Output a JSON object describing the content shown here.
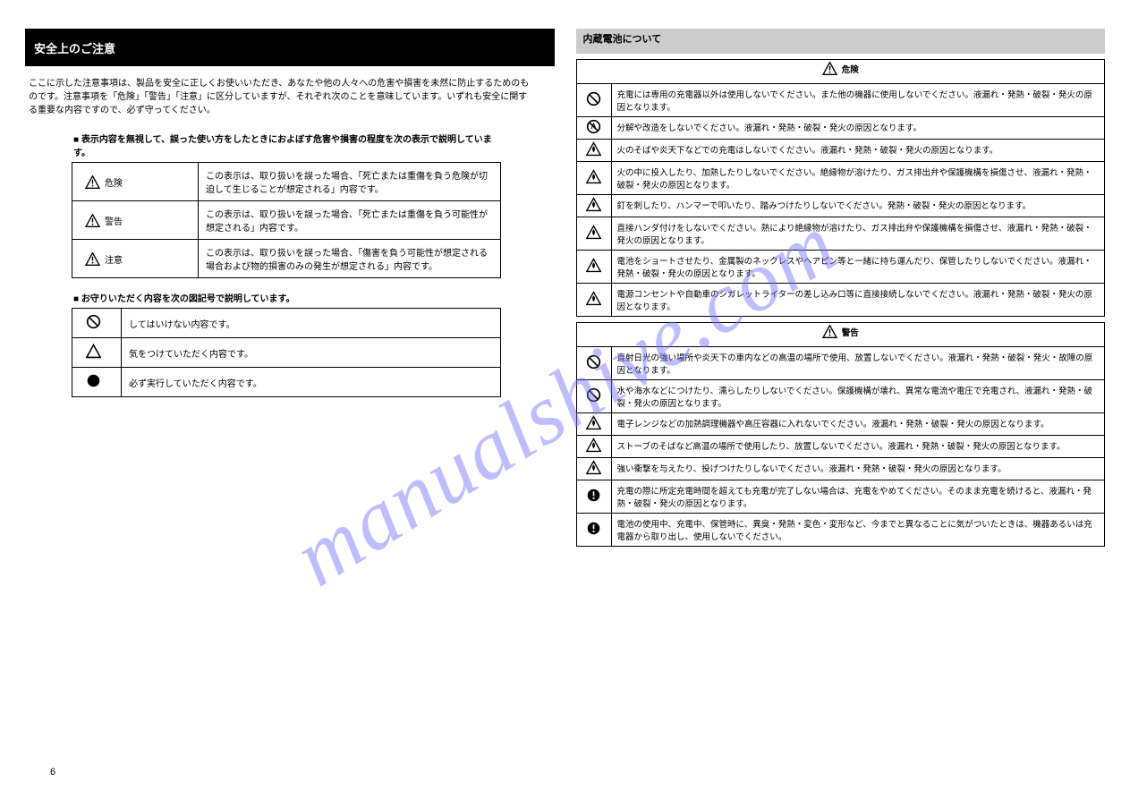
{
  "watermark": "manualshive.com",
  "left": {
    "header": "安全上のご注意",
    "intro": "ここに示した注意事項は、製品を安全に正しくお使いいただき、あなたや他の人々への危害や損害を未然に防止するためのものです。注意事項を「危険」「警告」「注意」に区分していますが、それぞれ次のことを意味しています。いずれも安全に関する重要な内容ですので、必ず守ってください。",
    "symExplain1": "■ 表示内容を無視して、誤った使い方をしたときにおよぼす危害や損害の程度を次の表示で説明しています。",
    "danger": {
      "label": "危険",
      "desc": "この表示は、取り扱いを誤った場合、「死亡または重傷を負う危険が切迫して生じることが想定される」内容です。"
    },
    "warning": {
      "label": "警告",
      "desc": "この表示は、取り扱いを誤った場合、「死亡または重傷を負う可能性が想定される」内容です。"
    },
    "caution": {
      "label": "注意",
      "desc": "この表示は、取り扱いを誤った場合、「傷害を負う可能性が想定される場合および物的損害のみの発生が想定される」内容です。"
    },
    "symExplain2": "■ お守りいただく内容を次の図記号で説明しています。",
    "prohibit": "してはいけない内容です。",
    "attention": "気をつけていただく内容です。",
    "mandatory": "必ず実行していただく内容です。"
  },
  "right": {
    "sectionTitle": "内蔵電池について",
    "dangerHeader": "危険",
    "dangerItems": [
      "充電には専用の充電器以外は使用しないでください。また他の機器に使用しないでください。液漏れ・発熱・破裂・発火の原因となります。",
      "分解や改造をしないでください。液漏れ・発熱・破裂・発火の原因となります。",
      "火のそばや炎天下などでの充電はしないでください。液漏れ・発熱・破裂・発火の原因となります。",
      "火の中に投入したり、加熱したりしないでください。絶縁物が溶けたり、ガス排出弁や保護機構を損傷させ、液漏れ・発熱・破裂・発火の原因となります。",
      "釘を刺したり、ハンマーで叩いたり、踏みつけたりしないでください。発熱・破裂・発火の原因となります。",
      "直接ハンダ付けをしないでください。熱により絶縁物が溶けたり、ガス排出弁や保護機構を損傷させ、液漏れ・発熱・破裂・発火の原因となります。",
      "電池をショートさせたり、金属製のネックレスやヘアピン等と一緒に持ち運んだり、保管したりしないでください。液漏れ・発熱・破裂・発火の原因となります。",
      "電源コンセントや自動車のシガレットライターの差し込み口等に直接接続しないでください。液漏れ・発熱・破裂・発火の原因となります。"
    ],
    "warningHeader": "警告",
    "warningItems": [
      "直射日光の強い場所や炎天下の車内などの高温の場所で使用、放置しないでください。液漏れ・発熱・破裂・発火・故障の原因となります。",
      "水や海水などにつけたり、濡らしたりしないでください。保護機構が壊れ、異常な電流や電圧で充電され、液漏れ・発熱・破裂・発火の原因となります。",
      "電子レンジなどの加熱調理機器や高圧容器に入れないでください。液漏れ・発熱・破裂・発火の原因となります。",
      "ストーブのそばなど高温の場所で使用したり、放置しないでください。液漏れ・発熱・破裂・発火の原因となります。",
      "強い衝撃を与えたり、投げつけたりしないでください。液漏れ・発熱・破裂・発火の原因となります。",
      "充電の際に所定充電時間を超えても充電が完了しない場合は、充電をやめてください。そのまま充電を続けると、液漏れ・発熱・破裂・発火の原因となります。",
      "電池の使用中、充電中、保管時に、異臭・発熱・変色・変形など、今までと異なることに気がついたときは、機器あるいは充電器から取り出し、使用しないでください。"
    ]
  },
  "pageNum": "6"
}
